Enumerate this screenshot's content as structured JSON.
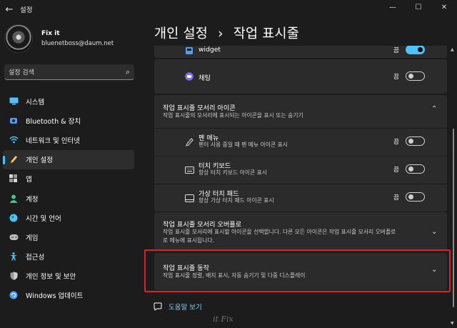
{
  "window": {
    "title": "설정",
    "back_glyph": "←",
    "minimize_glyph": "—",
    "maximize_glyph": "☐",
    "close_glyph": "✕"
  },
  "profile": {
    "name": "Fix it",
    "email": "bluenetboss@daum.net"
  },
  "search": {
    "placeholder": "설정 검색",
    "icon": "search-icon"
  },
  "sidebar": {
    "items": [
      {
        "label": "시스템",
        "icon": "monitor-icon",
        "color": "#4cc2ff"
      },
      {
        "label": "Bluetooth & 장치",
        "icon": "bluetooth-icon",
        "color": "#4c9bff"
      },
      {
        "label": "네트워크 및 인터넷",
        "icon": "wifi-icon",
        "color": "#4cc2ff"
      },
      {
        "label": "개인 설정",
        "icon": "pen-icon",
        "color": "#f7c95c"
      },
      {
        "label": "앱",
        "icon": "apps-icon",
        "color": "#d6d6d6"
      },
      {
        "label": "계정",
        "icon": "person-icon",
        "color": "#3fc48a"
      },
      {
        "label": "시간 및 언어",
        "icon": "globe-icon",
        "color": "#4cc2ff"
      },
      {
        "label": "게임",
        "icon": "gamepad-icon",
        "color": "#bdbdbd"
      },
      {
        "label": "접근성",
        "icon": "accessibility-icon",
        "color": "#4cc2ff"
      },
      {
        "label": "개인 정보 및 보안",
        "icon": "shield-icon",
        "color": "#9a9a9a"
      },
      {
        "label": "Windows 업데이트",
        "icon": "update-icon",
        "color": "#4c9bff"
      }
    ],
    "selected_index": 3,
    "accent": "#4cc2ff"
  },
  "breadcrumb": {
    "parent": "개인 설정",
    "separator": "›",
    "current": "작업 표시줄"
  },
  "content": {
    "widget_row": {
      "title": "widget",
      "toggle_label": "끔",
      "toggle_on": true
    },
    "chat_row": {
      "title": "채팅",
      "toggle_label": "끔",
      "toggle_on": false
    },
    "corner_icons": {
      "title": "작업 표시줄 모서리 아이콘",
      "subtitle": "작업 표시줄의 모서리에 표시되는 아이콘을 표시 또는 숨기기",
      "chevron": "⌃",
      "items": [
        {
          "title": "펜 메뉴",
          "subtitle": "펜이 사용 중일 때 펜 메뉴 아이콘 표시",
          "toggle_label": "끔",
          "icon": "pen-menu-icon"
        },
        {
          "title": "터치 키보드",
          "subtitle": "항상 터치 키보드 아이콘 표시",
          "toggle_label": "끔",
          "icon": "keyboard-icon"
        },
        {
          "title": "가상 터치 패드",
          "subtitle": "항상 가상 터치 패드 아이콘 표시",
          "toggle_label": "끔",
          "icon": "touchpad-icon"
        }
      ]
    },
    "overflow": {
      "title": "작업 표시줄 모서리 오버플로",
      "subtitle_line1": "작업 표시줄 모서리에 표시할 아이콘을 선택합니다. 다른 모든 아이콘은 작업 표시줄 모서리 오버플로",
      "subtitle_line2": "로 메뉴에 표시됩니다.",
      "chevron": "⌄"
    },
    "behaviors": {
      "title": "작업 표시줄 동작",
      "subtitle": "작업 표시줄 정렬, 배지 표시, 자동 숨기기 및 다중 디스플레이",
      "chevron": "⌄",
      "highlight_color": "#d9232a"
    }
  },
  "help": {
    "label": "도움말 보기",
    "icon": "help-chat-icon"
  },
  "watermark": "it Fix"
}
